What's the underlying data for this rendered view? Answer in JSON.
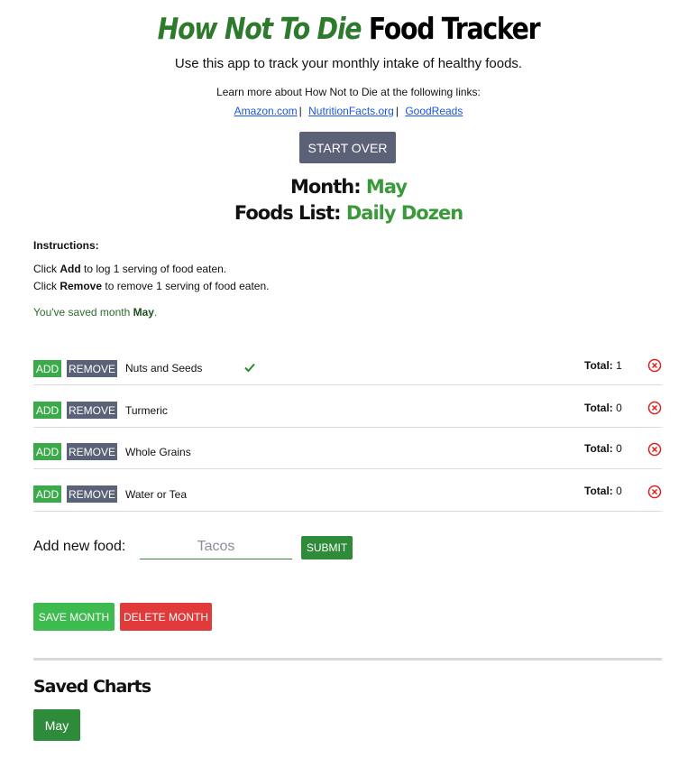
{
  "header": {
    "brand": "How Not To Die",
    "title_rest": "Food Tracker",
    "subtitle": "Use this app to track your monthly intake of healthy foods.",
    "learn_more": "Learn more about How Not to Die at the following links:",
    "links": [
      "Amazon.com",
      "NutritionFacts.org",
      "GoodReads"
    ],
    "link_separator": "|"
  },
  "start_over_label": "START OVER",
  "month": {
    "label": "Month:",
    "value": "May"
  },
  "foods_list": {
    "label": "Foods List:",
    "value": "Daily Dozen"
  },
  "instructions": {
    "title": "Instructions:",
    "line1_prefix": "Click",
    "line1_bold": "Add",
    "line1_suffix": "to log 1 serving of food eaten.",
    "line2_prefix": "Click",
    "line2_bold": "Remove",
    "line2_suffix": "to remove 1 serving of food eaten."
  },
  "saved_message": {
    "prefix": "You've saved month",
    "month": "May",
    "suffix": "."
  },
  "foods": [
    {
      "name": "Nuts and Seeds",
      "total_label": "Total:",
      "total": "1",
      "checked": true
    },
    {
      "name": "Turmeric",
      "total_label": "Total:",
      "total": "0",
      "checked": false
    },
    {
      "name": "Whole Grains",
      "total_label": "Total:",
      "total": "0",
      "checked": false
    },
    {
      "name": "Water or Tea",
      "total_label": "Total:",
      "total": "0",
      "checked": false
    }
  ],
  "row_buttons": {
    "add": "ADD",
    "remove": "REMOVE"
  },
  "add_food": {
    "label": "Add new food:",
    "placeholder": "Tacos",
    "value": "",
    "submit": "SUBMIT"
  },
  "save_month_label": "SAVE MONTH",
  "delete_month_label": "DELETE MONTH",
  "saved_charts": {
    "title": "Saved Charts",
    "items": [
      "May"
    ]
  },
  "colors": {
    "brand_green": "#2d7a2d",
    "accent_green": "#3a9a3a",
    "add_green": "#3aaa4a",
    "slate": "#5b6277",
    "danger_red": "#e03a3a",
    "delete_icon": "#e02020"
  },
  "icons": {
    "check": "check-icon",
    "delete": "close-circle-icon"
  }
}
